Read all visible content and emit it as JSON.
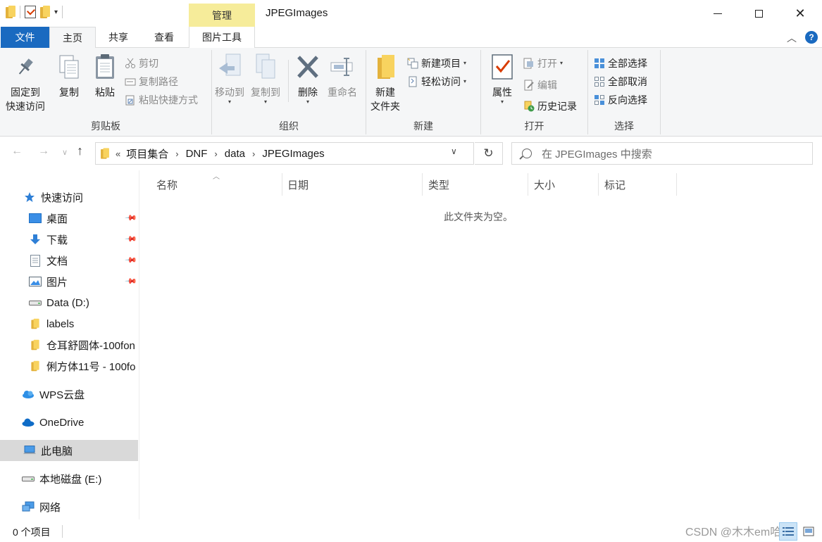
{
  "window": {
    "title": "JPEGImages",
    "contextual_tab_header": "管理"
  },
  "ribbon_tabs": {
    "file": "文件",
    "home": "主页",
    "share": "共享",
    "view": "查看",
    "picture_tools": "图片工具"
  },
  "clipboard": {
    "label": "剪贴板",
    "pin_line1": "固定到",
    "pin_line2": "快速访问",
    "copy": "复制",
    "paste": "粘贴",
    "cut": "剪切",
    "copy_path": "复制路径",
    "paste_shortcut": "粘贴快捷方式"
  },
  "organize": {
    "label": "组织",
    "move_to": "移动到",
    "copy_to": "复制到",
    "delete": "删除",
    "rename": "重命名"
  },
  "new": {
    "label": "新建",
    "new_folder_line1": "新建",
    "new_folder_line2": "文件夹",
    "new_item": "新建项目",
    "easy_access": "轻松访问"
  },
  "open": {
    "label": "打开",
    "properties": "属性",
    "open": "打开",
    "edit": "编辑",
    "history": "历史记录"
  },
  "select": {
    "label": "选择",
    "select_all": "全部选择",
    "select_none": "全部取消",
    "invert": "反向选择"
  },
  "address": {
    "overflow": "«",
    "crumbs": [
      "项目集合",
      "DNF",
      "data",
      "JPEGImages"
    ]
  },
  "search": {
    "placeholder": "在 JPEGImages 中搜索"
  },
  "nav": {
    "quick_access": "快速访问",
    "desktop": "桌面",
    "downloads": "下载",
    "documents": "文档",
    "pictures": "图片",
    "data_drive": "Data (D:)",
    "labels": "labels",
    "font1": "仓耳舒圆体-100fon",
    "font2": "俐方体11号 - 100fo",
    "wps": "WPS云盘",
    "onedrive": "OneDrive",
    "this_pc": "此电脑",
    "local_disk": "本地磁盘 (E:)",
    "network": "网络"
  },
  "columns": {
    "name": "名称",
    "date": "日期",
    "type": "类型",
    "size": "大小",
    "tags": "标记"
  },
  "content": {
    "empty_message": "此文件夹为空。"
  },
  "status": {
    "item_count": "0 个项目",
    "watermark": "CSDN @木木em哈哈"
  },
  "colors": {
    "file_tab": "#1a6ac0",
    "manage_tab": "#f6ec9a",
    "ribbon_bg": "#f5f6f7",
    "selected_nav": "#d9d9d9",
    "folder_yellow": "#f8d35f"
  }
}
